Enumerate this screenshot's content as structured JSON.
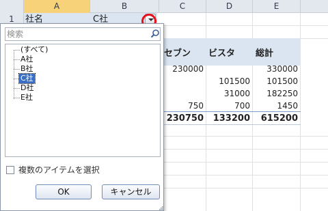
{
  "spreadsheet": {
    "columns": [
      "A",
      "B",
      "C",
      "D",
      "E"
    ],
    "rows": [
      "1"
    ],
    "filter_row": {
      "field_label": "社名",
      "field_value": "C社"
    },
    "pivot_header": {
      "col_c": "セブン",
      "col_d": "ビスタ",
      "col_e": "総計"
    },
    "data_rows": [
      {
        "c": "230000",
        "d": "",
        "e": "330000"
      },
      {
        "c": "",
        "d": "101500",
        "e": "101500"
      },
      {
        "c": "",
        "d": "31000",
        "e": "182250"
      },
      {
        "c": "750",
        "d": "700",
        "e": "1450"
      }
    ],
    "total_row": {
      "c": "230750",
      "d": "133200",
      "e": "615200"
    }
  },
  "filter_popup": {
    "search_placeholder": "検索",
    "items": [
      "(すべて)",
      "A社",
      "B社",
      "C社",
      "D社",
      "E社"
    ],
    "selected_item": "C社",
    "multi_select_label": "複数のアイテムを選択",
    "ok_label": "OK",
    "cancel_label": "キャンセル"
  },
  "colors": {
    "selected_item_bg": "#3a6fc4",
    "pivot_header_bg": "#dbe5f1",
    "highlight_ring": "#e8101a"
  },
  "icons": [
    "search-icon",
    "dropdown-arrow-icon",
    "resize-grip-icon"
  ]
}
